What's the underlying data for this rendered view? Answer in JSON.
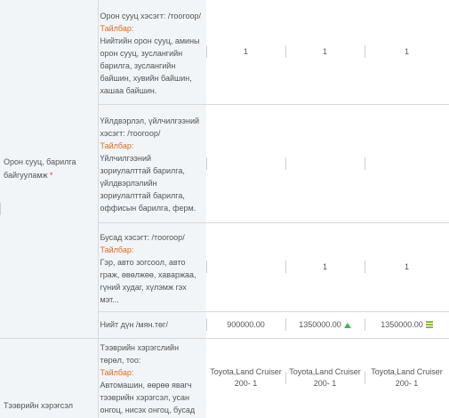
{
  "sections": [
    {
      "label": "Орон сууц, барилга байгууламж",
      "required_mark": "*",
      "rows": [
        {
          "title": "Орон сууц хэсэгт: /тоогоор/",
          "expl_label": "Тайлбар:",
          "desc": "Нийтийн орон сууц, амины орон сууц, зуслангийн барилга, зуслангийн байшин, хувийн байшин, хашаа байшин.",
          "values": [
            "1",
            "1",
            "1"
          ]
        },
        {
          "title": "Үйлдвэрлэл, үйлчилгээний хэсэгт: /тоогоор/",
          "expl_label": "Тайлбар:",
          "desc": "Үйлчилгээний зориулалттай барилга, үйлдвэрлэлийн зориулалттай барилга, оффисын барилга, ферм.",
          "values": [
            "",
            "",
            ""
          ]
        },
        {
          "title": "Бусад хэсэгт: /тоогоор/",
          "expl_label": "Тайлбар:",
          "desc": "Гэр, авто зогсоол, авто граж, өвөлжөө, хаваржаа, гүний худаг, хүлэмж гэх мэт...",
          "values": [
            "",
            "1",
            "1"
          ]
        }
      ],
      "total": {
        "label": "Нийт дүн /мян.төг/",
        "values": [
          "900000.00",
          "1350000.00",
          "1350000.00"
        ],
        "indicators": [
          "none",
          "up-arrow-icon",
          "equal-icon"
        ]
      }
    },
    {
      "label": "Тээврийн хэрэгсэл",
      "rows": [
        {
          "title": "Тээврийн хэрэгслийн төрөл, тоо:",
          "expl_label": "Тайлбар:",
          "desc": "Автомашин, өөрөө явагч тээврийн хэрэгсэл, усан онгоц, нисэх онгоц, бусад",
          "values": [
            {
              "line1": "Toyota,Land Cruiser",
              "line2": "200- 1"
            },
            {
              "line1": "Toyota,Land Cruiser",
              "line2": "200- 1"
            },
            {
              "line1": "Toyota,Land Cruiser",
              "line2": "200- 1"
            }
          ]
        }
      ]
    }
  ],
  "colors": {
    "label_bg": "#f1f5f8",
    "explanation": "#e36a1e",
    "required": "#e53935",
    "increase_icon": "#3dbb4c",
    "equal_icon": "#8bb83a"
  }
}
